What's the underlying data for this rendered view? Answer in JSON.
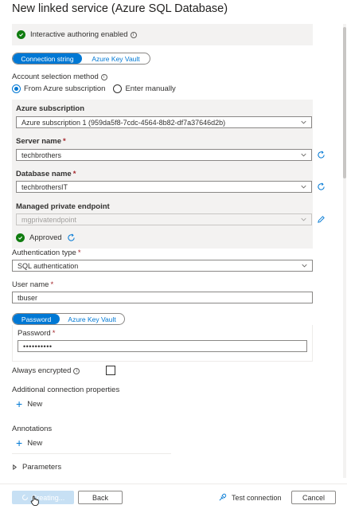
{
  "title": "New linked service (Azure SQL Database)",
  "interactive_authoring": {
    "text": "Interactive authoring enabled"
  },
  "connection_tabs": {
    "active": "Connection string",
    "other": "Azure Key Vault"
  },
  "account_selection": {
    "label": "Account selection method",
    "option_subscription": "From Azure subscription",
    "option_manual": "Enter manually"
  },
  "azure_subscription": {
    "label": "Azure subscription",
    "value": "Azure subscription 1 (959da5f8-7cdc-4564-8b82-df7a37646d2b)"
  },
  "server_name": {
    "label": "Server name",
    "value": "techbrothers"
  },
  "database_name": {
    "label": "Database name",
    "value": "techbrothersIT"
  },
  "managed_endpoint": {
    "label": "Managed private endpoint",
    "value": "mgprivatendpoint",
    "status": "Approved"
  },
  "auth_type": {
    "label": "Authentication type",
    "value": "SQL authentication"
  },
  "user_name": {
    "label": "User name",
    "value": "tbuser"
  },
  "password_tabs": {
    "active": "Password",
    "other": "Azure Key Vault"
  },
  "password": {
    "label": "Password",
    "value": "••••••••••"
  },
  "always_encrypted": {
    "label": "Always encrypted"
  },
  "additional_props": {
    "label": "Additional connection properties",
    "new_label": "New"
  },
  "annotations": {
    "label": "Annotations",
    "new_label": "New"
  },
  "parameters": {
    "label": "Parameters"
  },
  "footer": {
    "creating_label": "Creating...",
    "back_label": "Back",
    "test_label": "Test connection",
    "cancel_label": "Cancel"
  },
  "required_mark": "*",
  "colors": {
    "accent": "#0078d4",
    "success": "#107c10",
    "required": "#a4262c"
  }
}
